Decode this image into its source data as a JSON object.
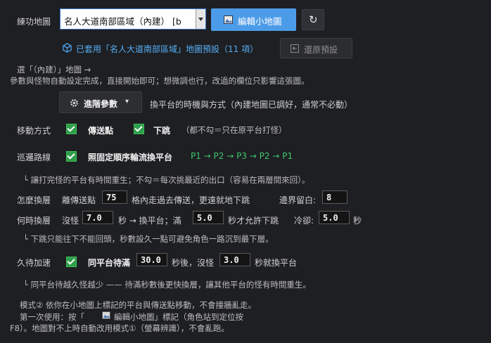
{
  "map": {
    "label": "練功地圖",
    "select_value": "名人大道南部區域（內建）  [b",
    "edit_button": "編輯小地圖",
    "refresh_icon": "↻"
  },
  "preset": {
    "status": "已套用「名人大道南部區域」地圖預設（11 項）",
    "restore_button": "還原預設"
  },
  "hint": {
    "line1": "選「（內建）」地圖 →",
    "line2": "參數與怪物自動設定完成，直接開始即可；想微調也行，改過的欄位只影響這張圖。"
  },
  "advanced": {
    "button": "進階參數",
    "caret": "▾",
    "desc": "換平台的時機與方式（內建地圖已調好，通常不必動）"
  },
  "move": {
    "label": "移動方式",
    "opt1": "傳送點",
    "opt2": "下跳",
    "note": "（都不勾＝只在原平台打怪）"
  },
  "patrol": {
    "label": "巡邏路線",
    "opt": "照固定順序輪流換平台",
    "route": "P1 → P2 → P3 → P2 → P1",
    "note": "└ 讓打完怪的平台有時間重生；不勾＝每次挑最近的出口（容易在兩層間來回）。"
  },
  "floor": {
    "label": "怎麼換層",
    "tp_pre": "離傳送點",
    "tp_value": "75",
    "tp_post": "格內走過去傳送，更遠就地下跳",
    "edge_label": "邊界留白:",
    "edge_value": "8"
  },
  "when": {
    "label": "何時換層",
    "no_mob": "沒怪",
    "no_mob_value": "7.0",
    "sec_switch": "秒 → 換平台；滿",
    "full_value": "5.0",
    "allow_jump": "秒才允許下跳",
    "cooldown_label": "冷卻:",
    "cooldown_value": "5.0",
    "sec": "秒",
    "note": "└ 下跳只能往下不能回頭，秒數設久一點可避免角色一路沉到最下層。"
  },
  "wait": {
    "label": "久待加速",
    "opt": "同平台待滿",
    "value1": "30.0",
    "mid": "秒後，沒怪",
    "value2": "3.0",
    "post": "秒就換平台",
    "note": "└ 同平台待越久怪越少 —— 待滿秒數後更快換層，讓其他平台的怪有時間重生。"
  },
  "mode": {
    "line1": "模式② 依你在小地圖上標記的平台與傳送點移動，不會撞牆亂走。",
    "line2": "第一次使用：按「",
    "line2b": "編輯小地圖」標記（角色站到定位按",
    "line3": "F8）。地圖對不上時自動改用模式①（螢幕辨識），不會亂跑。"
  }
}
